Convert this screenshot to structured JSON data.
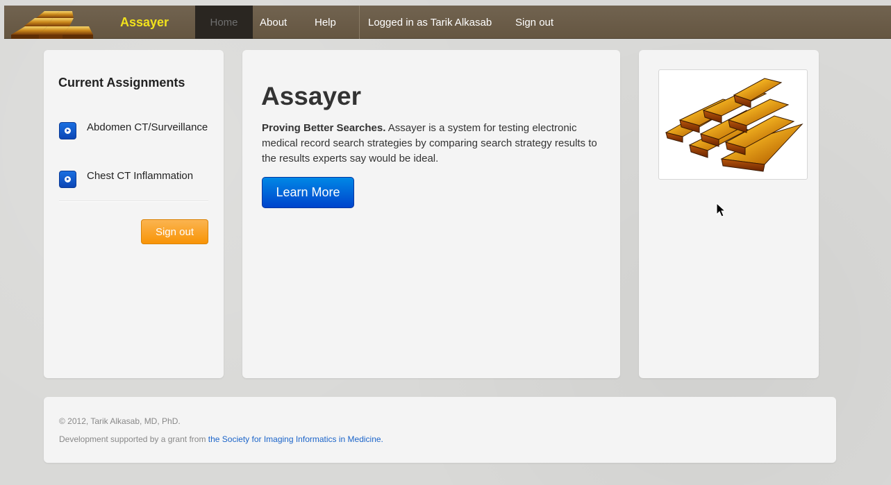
{
  "nav": {
    "brand": "Assayer",
    "home": "Home",
    "about": "About",
    "help": "Help",
    "logged_in": "Logged in as Tarik Alkasab",
    "sign_out": "Sign out"
  },
  "sidebar": {
    "title": "Current Assignments",
    "assignments": [
      {
        "label": "Abdomen CT/Surveillance"
      },
      {
        "label": "Chest CT Inflammation"
      }
    ],
    "sign_out_label": "Sign out"
  },
  "main": {
    "title": "Assayer",
    "tagline": "Proving Better Searches.",
    "description": " Assayer is a system for testing electronic medical record search strategies by comparing search strategy results to the results experts say would be ideal.",
    "learn_more": "Learn More"
  },
  "footer": {
    "copyright": "© 2012, Tarik Alkasab, MD, PhD.",
    "support_prefix": "Development supported by a grant from ",
    "support_link": "the Society for Imaging Informatics in Medicine."
  },
  "colors": {
    "navbar": "#6b5d47",
    "brand": "#f2e21c",
    "primary_button": "#0044cc",
    "warning_button": "#f89406",
    "link": "#1b64c9"
  },
  "icons": {
    "logo": "gold-bars-icon",
    "assignment": "arrow-circle-right-icon",
    "hero_image": "gold-bars-image"
  }
}
